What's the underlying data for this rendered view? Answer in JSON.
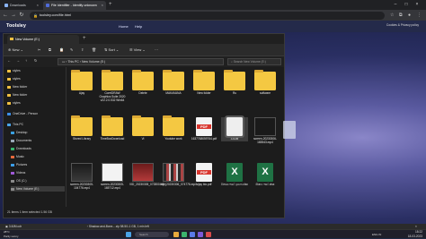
{
  "browser": {
    "tabs": [
      {
        "label": "Downloads",
        "active": false
      },
      {
        "label": "File Identifier - Identify unknown",
        "active": true
      }
    ],
    "url": "toolsley.com/file.html",
    "bookmark_label": "All Bookmarks"
  },
  "site": {
    "logo": "Toolsley",
    "nav": [
      "Home",
      "Help"
    ],
    "cookie_text": "Cookies & Privacy policy"
  },
  "explorer": {
    "window_title": "New Volume (E:)",
    "cmd": {
      "new": "New",
      "sort": "Sort",
      "view": "View"
    },
    "path": [
      "This PC",
      "New Volume (E:)"
    ],
    "search_placeholder": "Search New Volume (E:)",
    "sidebar": [
      {
        "label": "styles",
        "icon": "folder-icon"
      },
      {
        "label": "styles",
        "icon": "folder-icon"
      },
      {
        "label": "New folder",
        "icon": "folder-icon"
      },
      {
        "label": "New folder",
        "icon": "folder-icon"
      },
      {
        "label": "styles",
        "icon": "folder-icon"
      },
      {
        "label": "OneDrive - Person",
        "icon": "cloud-icon"
      },
      {
        "label": "This PC",
        "icon": "pc-icon"
      },
      {
        "label": "Desktop",
        "icon": "desktop-icon"
      },
      {
        "label": "Documents",
        "icon": "documents-icon"
      },
      {
        "label": "Downloads",
        "icon": "download-icon"
      },
      {
        "label": "Music",
        "icon": "music-icon"
      },
      {
        "label": "Pictures",
        "icon": "pictures-icon"
      },
      {
        "label": "Videos",
        "icon": "videos-icon"
      },
      {
        "label": "OS (C:)",
        "icon": "drive-icon"
      },
      {
        "label": "New Volume (E:)",
        "icon": "drive-icon",
        "selected": true
      }
    ],
    "items": [
      {
        "name": "Ajay",
        "kind": "folder"
      },
      {
        "name": "CorelDRAW Graphics Suite 2020 v22.2.0.532 Win64",
        "kind": "folder"
      },
      {
        "name": "Delete",
        "kind": "folder"
      },
      {
        "name": "MAKAVANA",
        "kind": "folder"
      },
      {
        "name": "New folder",
        "kind": "folder"
      },
      {
        "name": "Ru",
        "kind": "folder"
      },
      {
        "name": "software",
        "kind": "folder"
      },
      {
        "name": "Stored Library",
        "kind": "folder"
      },
      {
        "name": "TimeBoxDownload",
        "kind": "folder"
      },
      {
        "name": "Vi",
        "kind": "folder"
      },
      {
        "name": "Youtube work",
        "kind": "folder"
      },
      {
        "name": "1637768059764.pdf",
        "kind": "pdf"
      },
      {
        "name": "3.8JM",
        "kind": "doc",
        "selected": true
      },
      {
        "name": "screen-20230306-165543.mp4",
        "kind": "video"
      },
      {
        "name": "screen-20230305-104776.mp4",
        "kind": "video"
      },
      {
        "name": "screen-20230305-165712.mp4",
        "kind": "video-white"
      },
      {
        "name": "VID_20230305_072800.mp4",
        "kind": "video-red"
      },
      {
        "name": "VID_20230306_074776.mp4",
        "kind": "video-film"
      },
      {
        "name": "vijay bio.pdf",
        "kind": "pdf"
      },
      {
        "name": "વિજય ભાઈ ફાઇલ.xlsx",
        "kind": "excel"
      },
      {
        "name": "શિક્ષક ભાઈ.xlsx",
        "kind": "excel"
      }
    ],
    "status": "21 items    1 item selected  1.56 GB"
  },
  "downloads": [
    {
      "label": "3.8JM.cdr"
    },
    {
      "label": "Shadow-and-Bone-...zip",
      "sub": "58.5/1.1 GB, 1 min left"
    }
  ],
  "taskbar": {
    "weather_temp": "28°C",
    "weather_desc": "Partly sunny",
    "search_label": "Search",
    "time": "18:22",
    "date": "18-03-2023",
    "lang": "ENG IN"
  }
}
